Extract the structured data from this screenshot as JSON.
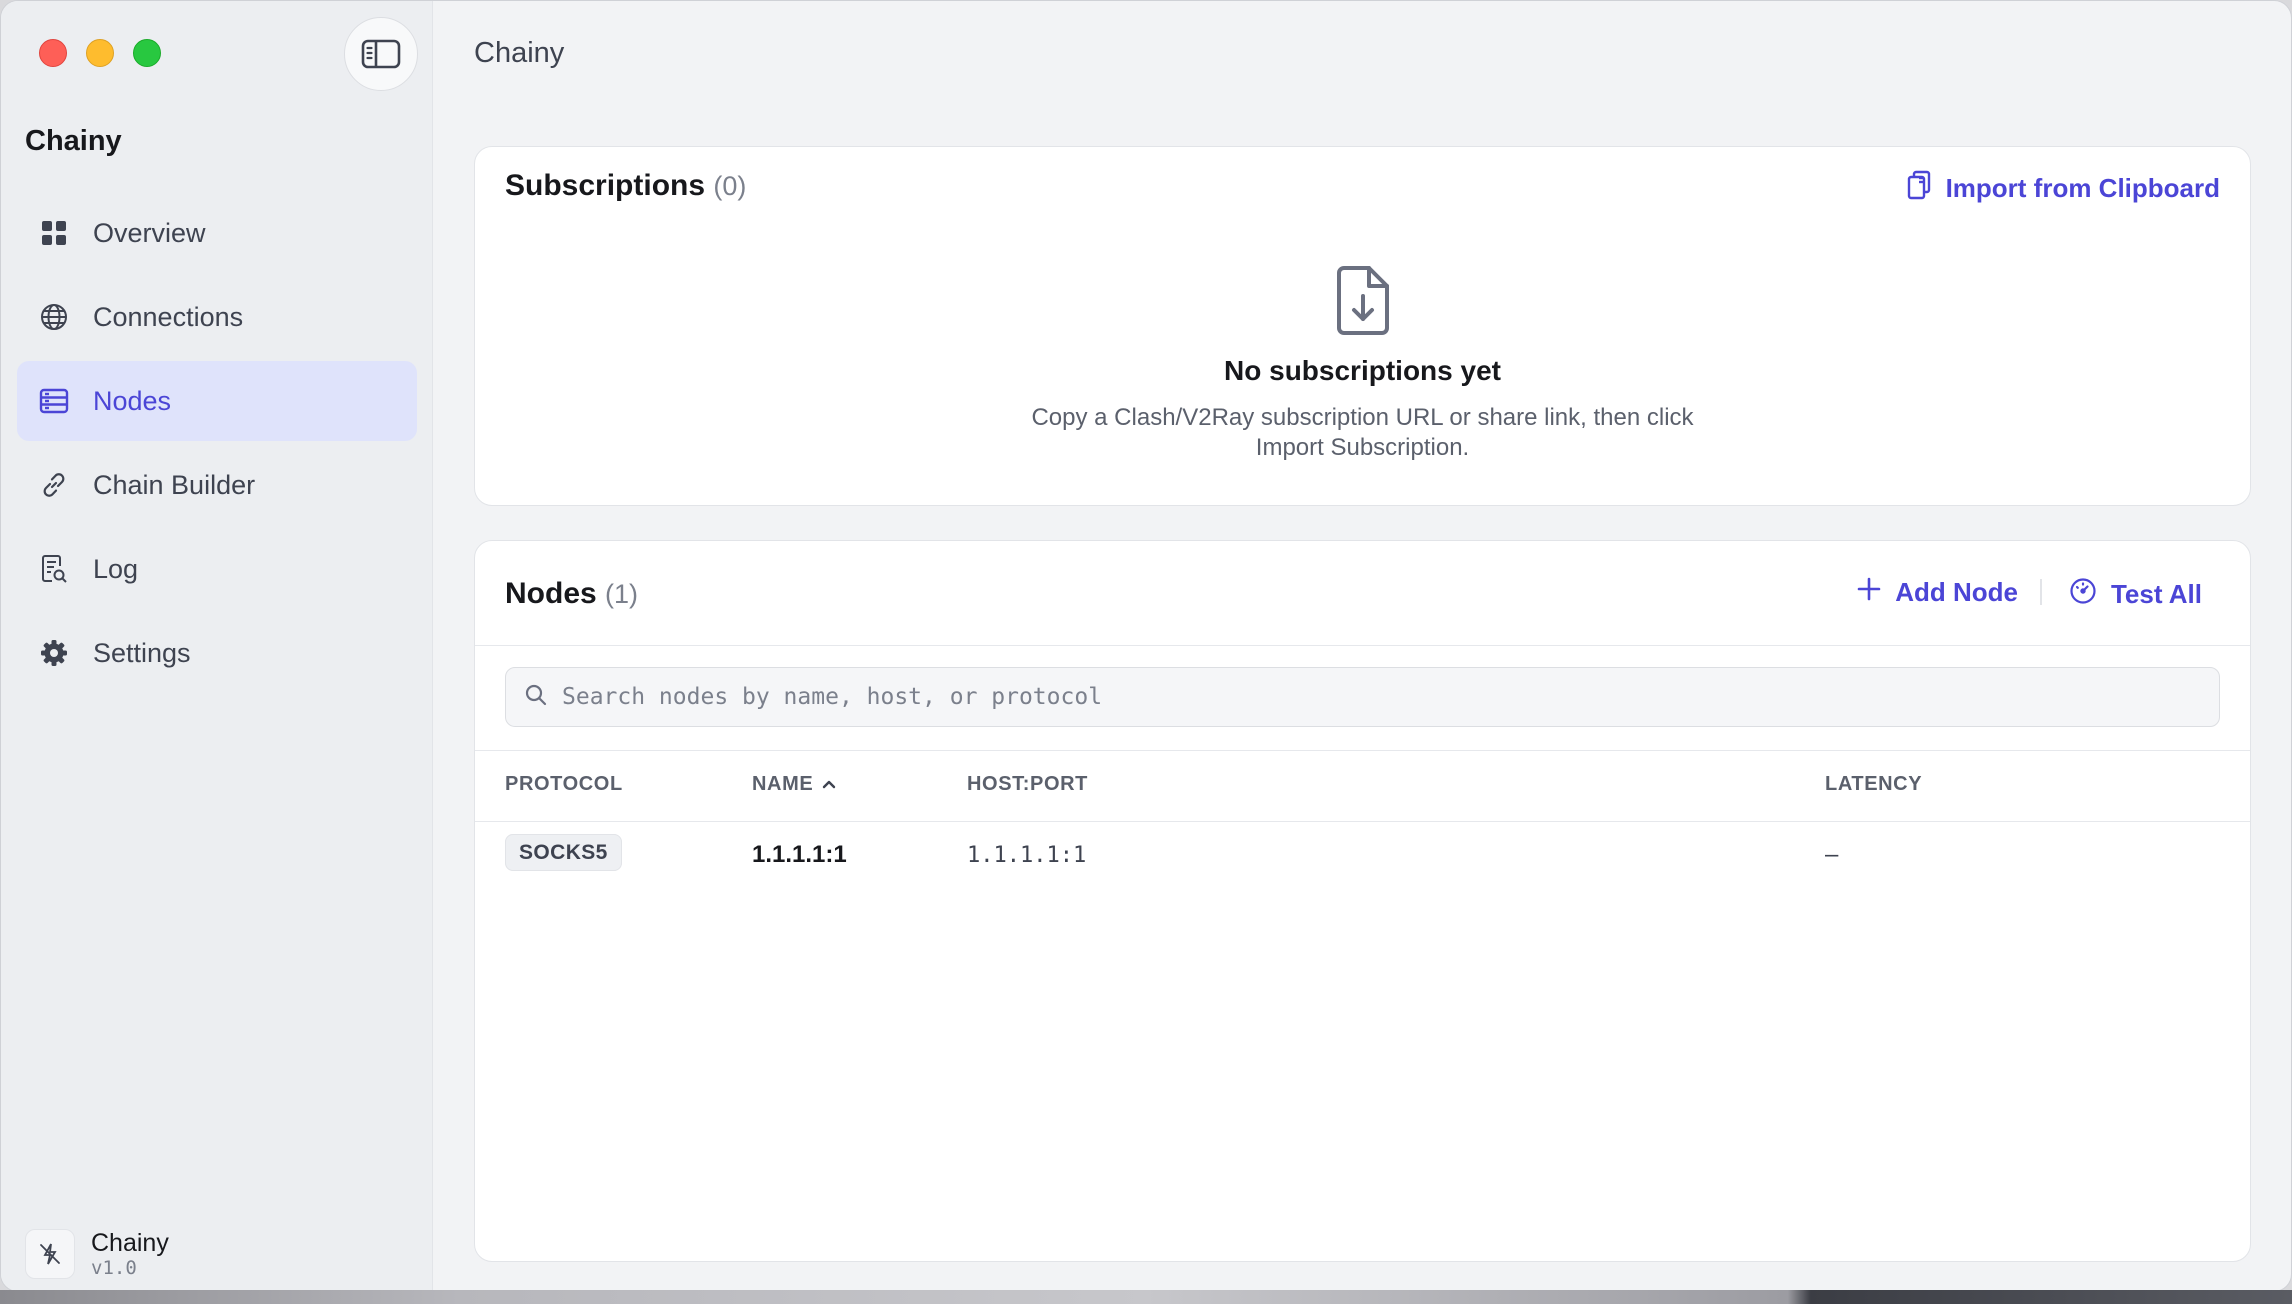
{
  "app": {
    "window_title": "Chainy",
    "sidebar_title": "Chainy"
  },
  "sidebar": {
    "items": [
      {
        "label": "Overview",
        "icon": "grid-icon"
      },
      {
        "label": "Connections",
        "icon": "globe-icon"
      },
      {
        "label": "Nodes",
        "icon": "server-icon",
        "active": true
      },
      {
        "label": "Chain Builder",
        "icon": "link-icon"
      },
      {
        "label": "Log",
        "icon": "document-search-icon"
      },
      {
        "label": "Settings",
        "icon": "gear-icon"
      }
    ],
    "profile": {
      "name": "Chainy",
      "version": "v1.0"
    }
  },
  "subscriptions": {
    "title": "Subscriptions",
    "count": "(0)",
    "import_label": "Import from Clipboard",
    "empty_title": "No subscriptions yet",
    "empty_desc": "Copy a Clash/V2Ray subscription URL or share link, then click Import Subscription."
  },
  "nodes": {
    "title": "Nodes",
    "count": "(1)",
    "add_label": "Add Node",
    "test_label": "Test All",
    "search_placeholder": "Search nodes by name, host, or protocol",
    "columns": {
      "protocol": "PROTOCOL",
      "name": "NAME",
      "host_port": "HOST:PORT",
      "latency": "LATENCY"
    },
    "rows": [
      {
        "protocol": "SOCKS5",
        "name": "1.1.1.1:1",
        "host_port": "1.1.1.1:1",
        "latency": "–"
      }
    ]
  },
  "colors": {
    "accent": "#4b45d6",
    "active_bg": "#dfe3fb",
    "sidebar_bg": "#eceef1",
    "page_bg": "#f2f3f5"
  }
}
